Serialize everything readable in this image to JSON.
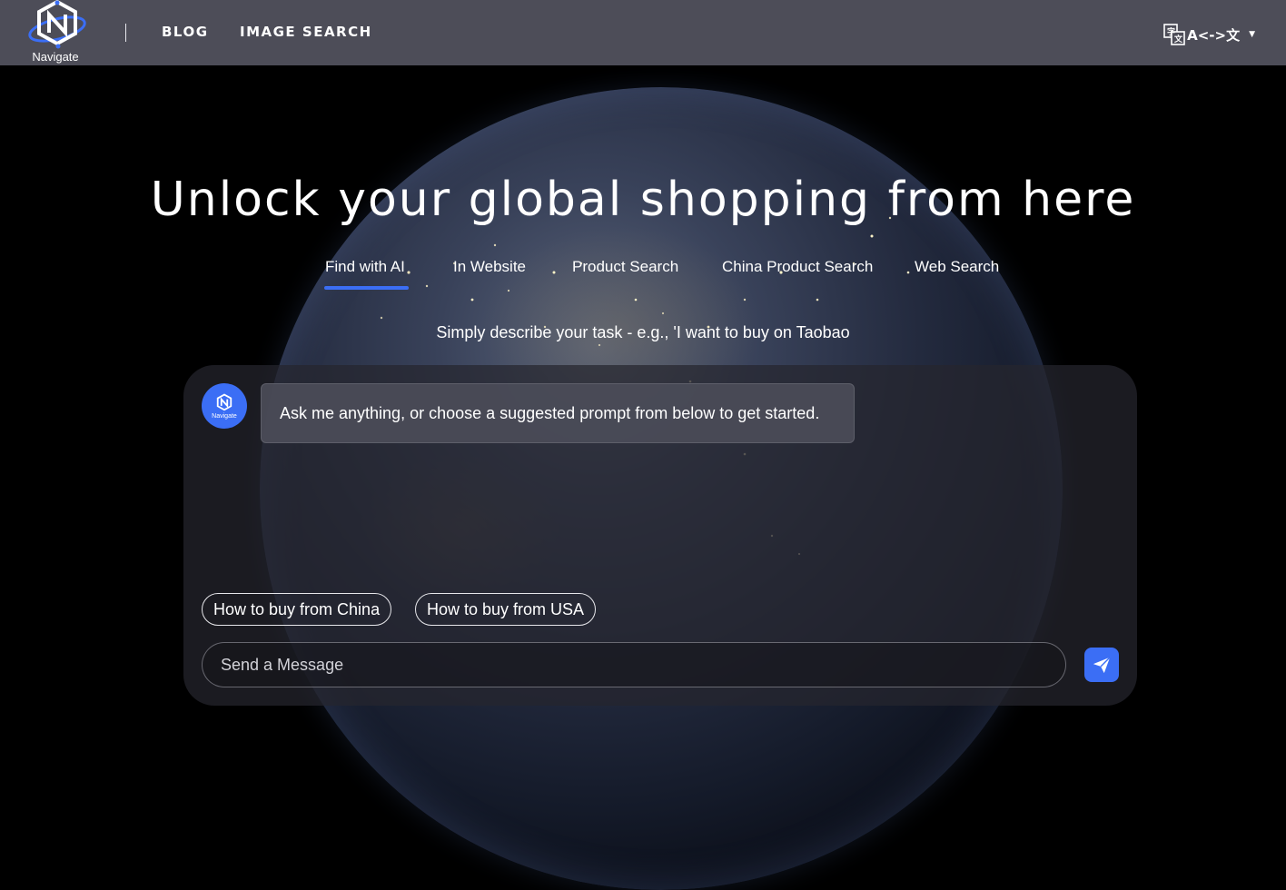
{
  "brand": {
    "logo_text": "Navigate"
  },
  "nav": {
    "blog": "BLOG",
    "image_search": "IMAGE SEARCH"
  },
  "language_switch": {
    "label": "A<->文"
  },
  "hero": {
    "title": "Unlock your global shopping from here",
    "tabs": [
      "Find with AI",
      "In Website",
      "Product Search",
      "China Product Search",
      "Web Search"
    ],
    "active_tab": "Find with AI",
    "hint": "Simply describe your task - e.g., 'I want to buy on Taobao"
  },
  "chat": {
    "avatar_text": "Navigate",
    "welcome_message": "Ask me anything, or choose a suggested prompt from below to get started.",
    "suggestions": [
      "How to buy from China",
      "How to buy from USA"
    ],
    "input_placeholder": "Send a Message"
  },
  "colors": {
    "header_bg": "#4d4d58",
    "accent": "#3b6ef5",
    "panel_bg": "#26262e"
  }
}
